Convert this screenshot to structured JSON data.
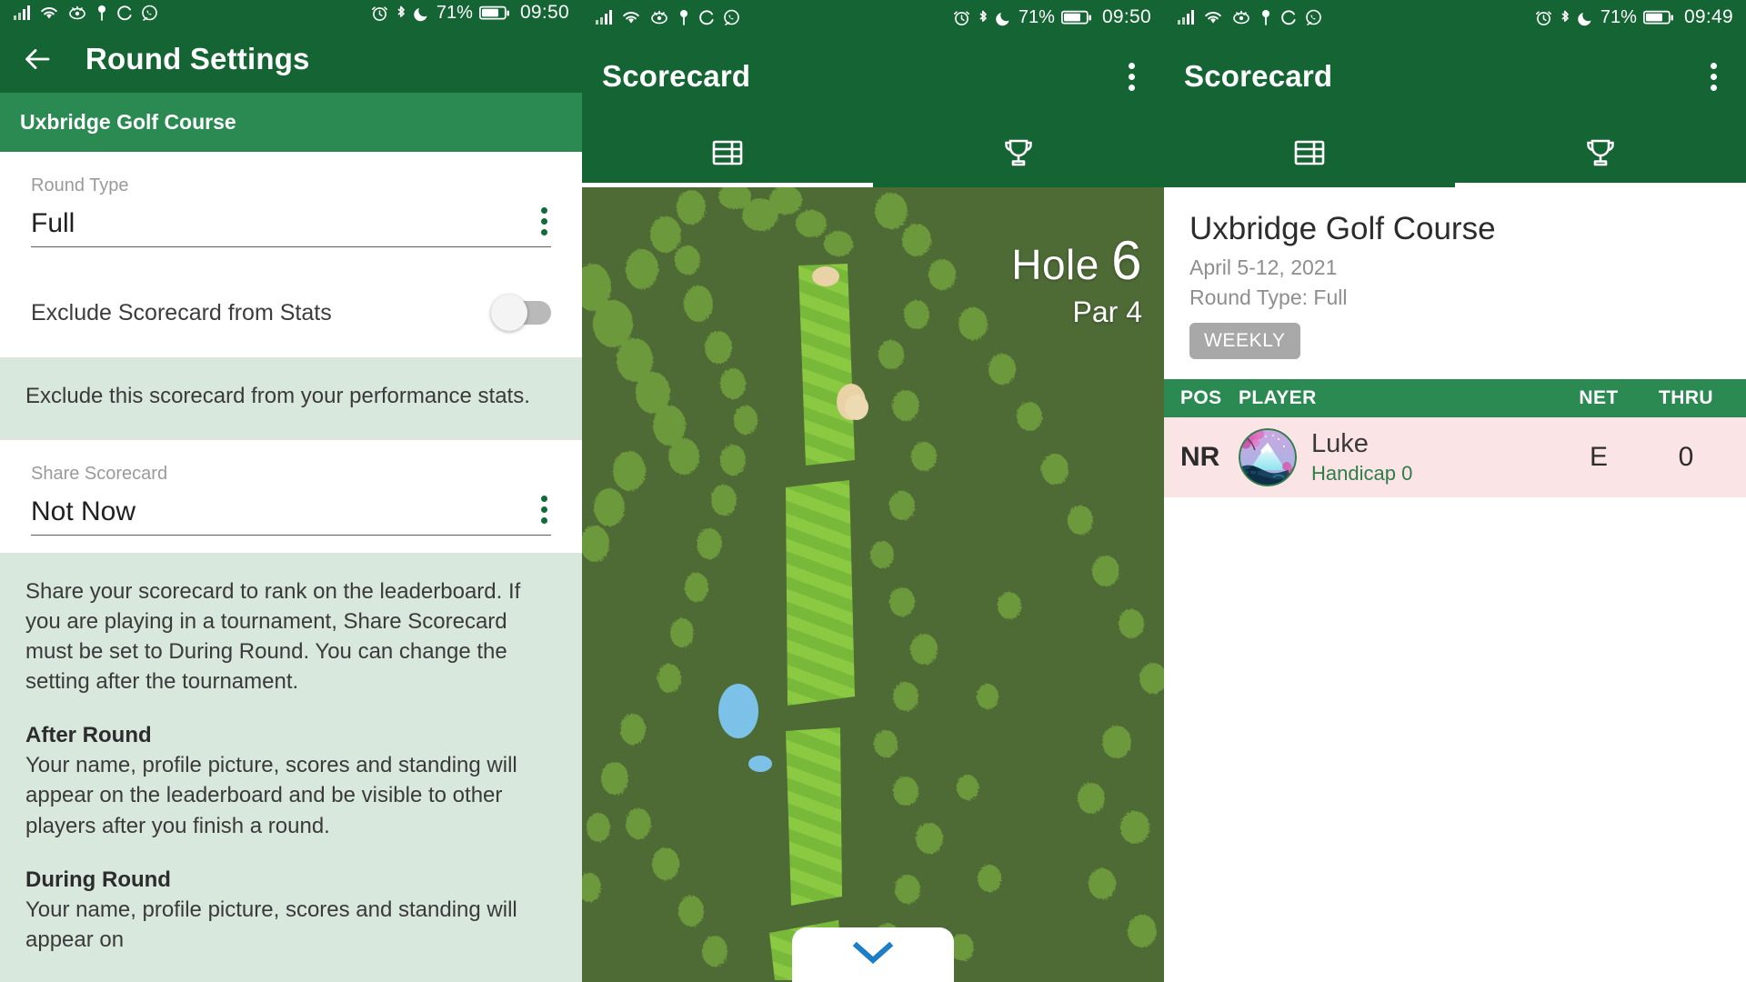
{
  "theme": {
    "primary": "#146434",
    "accent": "#2b8a52",
    "info_bg": "#d9e8dc",
    "row_highlight": "#fbe4e6",
    "handicap_green": "#2f7d49",
    "badge_grey": "#a8a8a8",
    "chevron_blue": "#1c7ec4"
  },
  "status_bars": [
    {
      "time": "09:50",
      "battery": "71%",
      "left_icons": [
        "signal-icon",
        "wifi-icon",
        "eye-care-icon",
        "location-icon",
        "sync-icon",
        "whatsapp-icon"
      ],
      "right_icons": [
        "alarm-icon",
        "bluetooth-icon",
        "do-not-disturb-icon",
        "battery-icon"
      ]
    },
    {
      "time": "09:50",
      "battery": "71%",
      "left_icons": [
        "signal-icon",
        "wifi-icon",
        "eye-care-icon",
        "location-icon",
        "sync-icon",
        "whatsapp-icon"
      ],
      "right_icons": [
        "alarm-icon",
        "bluetooth-icon",
        "do-not-disturb-icon",
        "battery-icon"
      ]
    },
    {
      "time": "09:49",
      "battery": "71%",
      "left_icons": [
        "signal-icon",
        "wifi-icon",
        "eye-care-icon",
        "location-icon",
        "sync-icon",
        "whatsapp-icon"
      ],
      "right_icons": [
        "alarm-icon",
        "bluetooth-icon",
        "do-not-disturb-icon",
        "battery-icon"
      ]
    }
  ],
  "panel1": {
    "appbar": {
      "title": "Round Settings",
      "back_icon": "back-arrow-icon"
    },
    "course_band": "Uxbridge Golf Course",
    "round_type": {
      "label": "Round Type",
      "value": "Full"
    },
    "exclude_toggle": {
      "label": "Exclude Scorecard from Stats",
      "state": "off"
    },
    "exclude_info": "Exclude this scorecard from your performance stats.",
    "share": {
      "label": "Share Scorecard",
      "value": "Not Now"
    },
    "share_info_main": "Share your scorecard to rank on the leaderboard. If you are playing in a tournament, Share Scorecard must be set to During Round. You can change the setting after the tournament.",
    "share_info_sections": [
      {
        "heading": "After Round",
        "body": "Your name, profile picture, scores and standing will appear on the leaderboard and be visible to other players after you finish a round."
      },
      {
        "heading": "During Round",
        "body": "Your name, profile picture, scores and standing will appear on"
      }
    ]
  },
  "panel2": {
    "appbar": {
      "title": "Scorecard",
      "overflow_icon": "kebab-menu-icon"
    },
    "tabs": [
      {
        "label": "",
        "icon": "scorecard-table-icon",
        "active": true
      },
      {
        "label": "",
        "icon": "trophy-icon",
        "active": false
      }
    ],
    "hole": {
      "prefix": "Hole",
      "number": "6",
      "par": "Par 4"
    },
    "sheet_handle_icon": "chevron-down-icon"
  },
  "panel3": {
    "appbar": {
      "title": "Scorecard",
      "overflow_icon": "kebab-menu-icon"
    },
    "tabs": [
      {
        "label": "",
        "icon": "scorecard-table-icon",
        "active": false
      },
      {
        "label": "",
        "icon": "trophy-icon",
        "active": true
      }
    ],
    "header": {
      "course": "Uxbridge Golf Course",
      "date": "April 5-12, 2021",
      "round_type": "Round Type: Full",
      "badge": "WEEKLY"
    },
    "columns": {
      "pos": "POS",
      "player": "PLAYER",
      "net": "NET",
      "thru": "THRU"
    },
    "rows": [
      {
        "pos": "NR",
        "avatar": "mount-fuji-avatar",
        "name": "Luke",
        "handicap": "Handicap 0",
        "net": "E",
        "thru": "0"
      }
    ]
  }
}
